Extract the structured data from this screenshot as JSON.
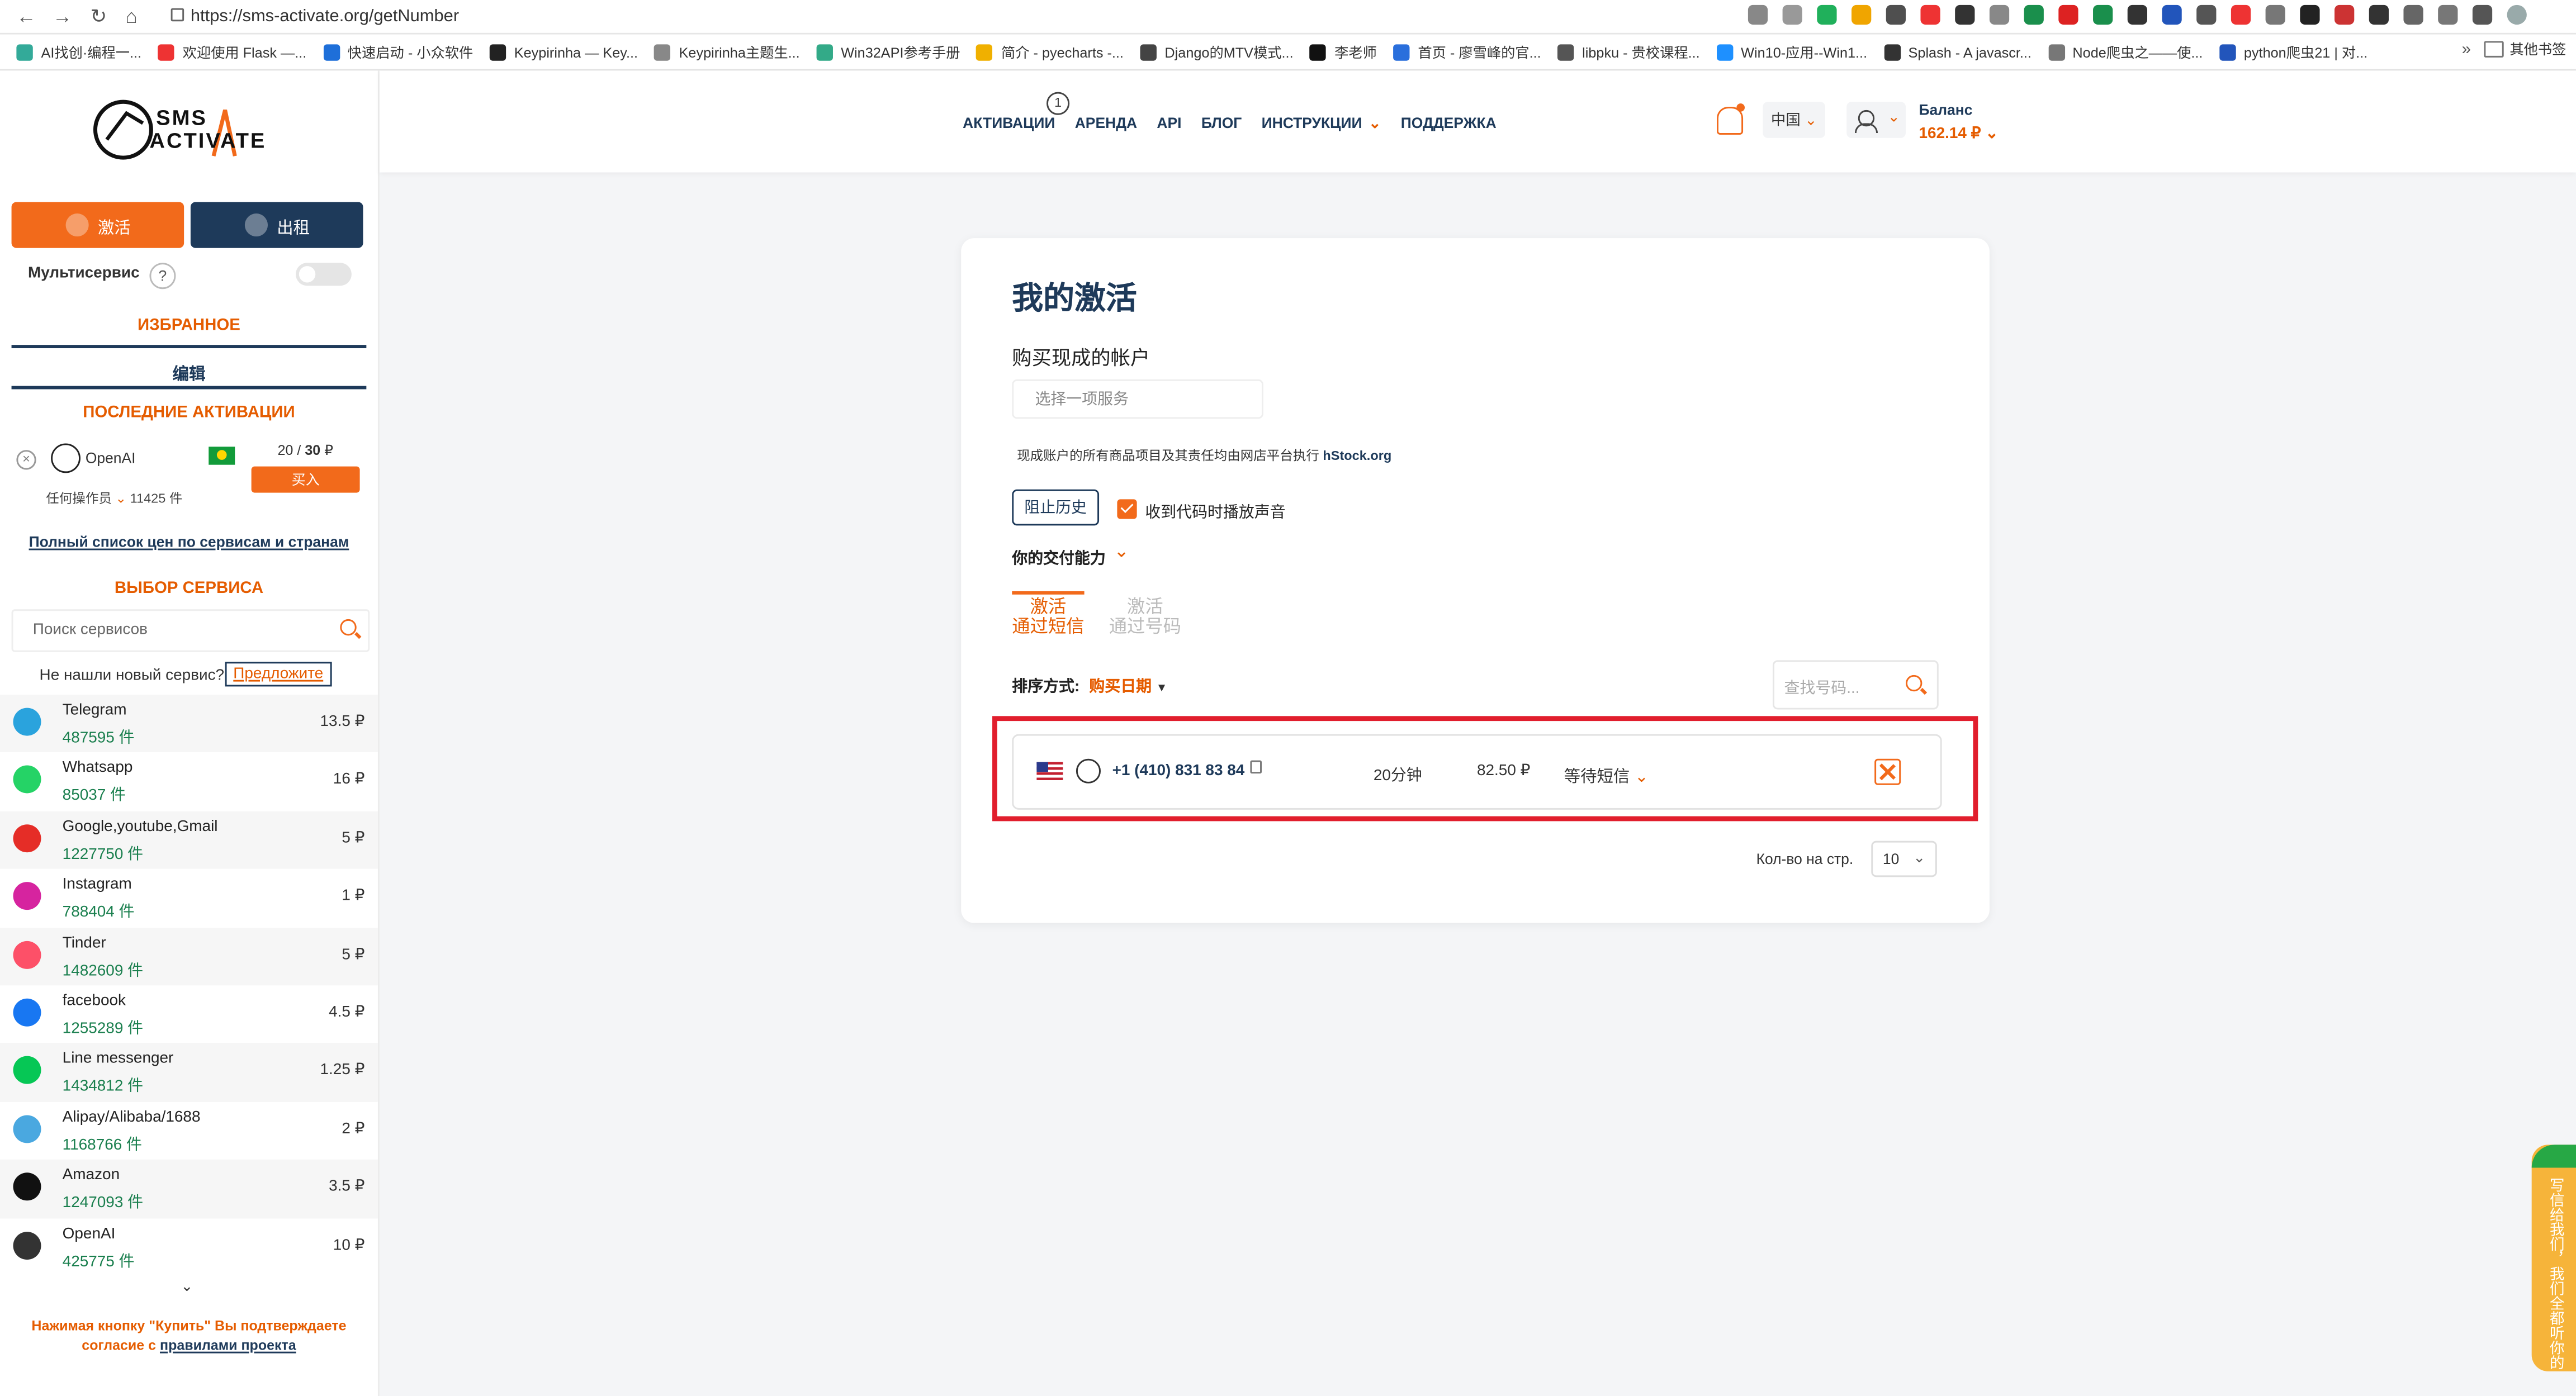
{
  "browser": {
    "url": "https://sms-activate.org/getNumber",
    "url_host": "sms-activate.org",
    "url_path": "/getNumber",
    "bookmarks": [
      "AI找创·编程一...",
      "欢迎使用 Flask —...",
      "快速启动 - 小众软件",
      "Keypirinha — Key...",
      "Keypirinha主题生...",
      "Win32API参考手册",
      "简介 - pyecharts -...",
      "Django的MTV模式...",
      "李老师",
      "首页 - 廖雪峰的官...",
      "libpku - 贵校课程...",
      "Win10-应用--Win1...",
      "Splash - A javascr...",
      "Node爬虫之——使...",
      "python爬虫21 | 对..."
    ],
    "more": "»",
    "other_bookmarks": "其他书签"
  },
  "sidebar": {
    "logo_line1": "SMS",
    "logo_line2": "ACTIVATE",
    "activate_btn": "激活",
    "rent_btn": "出租",
    "multiservice": "Мультисервис",
    "help": "?",
    "favorites_title": "ИЗБРАННОЕ",
    "edit": "编辑",
    "recent_title": "ПОСЛЕДНИЕ АКТИВАЦИИ",
    "recent": {
      "name": "OpenAI",
      "count_current": "20",
      "count_sep": " / ",
      "count_total": "30",
      "currency": " ₽",
      "buy": "买入",
      "operator": "任何操作员",
      "available": "11425 件"
    },
    "full_list": "Полный список цен по сервисам и странам",
    "choose_title": "ВЫБОР СЕРВИСА",
    "search_placeholder": "Поиск сервисов",
    "not_found": "Не нашли новый сервис?",
    "suggest": "Предложите",
    "services": [
      {
        "name": "Telegram",
        "qty": "487595 件",
        "price": "13.5 ₽",
        "icon": "telegram-icon",
        "color": "#2aa3dd"
      },
      {
        "name": "Whatsapp",
        "qty": "85037 件",
        "price": "16 ₽",
        "icon": "whatsapp-icon",
        "color": "#25d366"
      },
      {
        "name": "Google,youtube,Gmail",
        "qty": "1227750 件",
        "price": "5 ₽",
        "icon": "youtube-icon",
        "color": "#e52d27"
      },
      {
        "name": "Instagram",
        "qty": "788404 件",
        "price": "1 ₽",
        "icon": "instagram-icon",
        "color": "#d6249f"
      },
      {
        "name": "Tinder",
        "qty": "1482609 件",
        "price": "5 ₽",
        "icon": "tinder-icon",
        "color": "#fd5068"
      },
      {
        "name": "facebook",
        "qty": "1255289 件",
        "price": "4.5 ₽",
        "icon": "facebook-icon",
        "color": "#1877f2"
      },
      {
        "name": "Line messenger",
        "qty": "1434812 件",
        "price": "1.25 ₽",
        "icon": "line-icon",
        "color": "#06c755"
      },
      {
        "name": "Alipay/Alibaba/1688",
        "qty": "1168766 件",
        "price": "2 ₽",
        "icon": "alipay-icon",
        "color": "#4aa8e0"
      },
      {
        "name": "Amazon",
        "qty": "1247093 件",
        "price": "3.5 ₽",
        "icon": "amazon-icon",
        "color": "#111111"
      },
      {
        "name": "OpenAI",
        "qty": "425775 件",
        "price": "10 ₽",
        "icon": "openai-icon",
        "color": "#333333"
      }
    ],
    "more_chevron": "⌄",
    "disclaimer_text": "Нажимая кнопку \"Купить\" Вы подтверждаете согласие с",
    "disclaimer_link": "правилами проекта"
  },
  "header": {
    "menu": [
      "АКТИВАЦИИ",
      "АРЕНДА",
      "API",
      "БЛОГ",
      "ИНСТРУКЦИИ",
      "ПОДДЕРЖКА"
    ],
    "activations_badge": "1",
    "region": "中国",
    "balance_label": "Баланс",
    "balance_value": "162.14 ₽"
  },
  "main": {
    "title": "我的激活",
    "subtitle": "购买现成的帐户",
    "select_placeholder": "选择一项服务",
    "notice_text": "现成账户的所有商品项目及其责任均由网店平台执行",
    "notice_link": "hStock.org",
    "block_history": "阻止历史",
    "sound_label": "收到代码时播放声音",
    "sound_checked": true,
    "payment": "你的交付能力",
    "tab_active_line1": "激活",
    "tab_active_line2": "通过短信",
    "tab_inactive_line1": "激活",
    "tab_inactive_line2": "通过号码",
    "sort_label": "排序方式:",
    "sort_value": "购买日期",
    "find_placeholder": "查找号码...",
    "activation": {
      "phone": "+1 (410) 831 83 84",
      "time": "20分钟",
      "price": "82.50 ₽",
      "status": "等待短信"
    },
    "per_page_label": "Кол-во на стр.",
    "per_page_value": "10"
  },
  "feedback": "写信给我们，我们全都听你的",
  "colors": {
    "accent": "#f26a1b",
    "navy": "#1e3a5a",
    "highlight": "#e11e2d"
  }
}
